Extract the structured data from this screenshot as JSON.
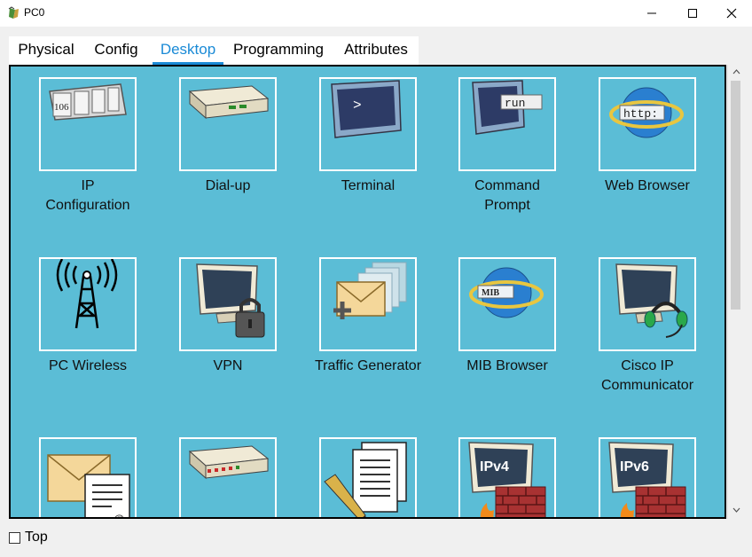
{
  "window": {
    "title": "PC0",
    "app_icon": "packet-tracer-pc-icon"
  },
  "tabs": [
    {
      "label": "Physical",
      "active": false
    },
    {
      "label": "Config",
      "active": false
    },
    {
      "label": "Desktop",
      "active": true
    },
    {
      "label": "Programming",
      "active": false
    },
    {
      "label": "Attributes",
      "active": false
    }
  ],
  "apps": [
    {
      "line1": "IP",
      "line2": "Configuration",
      "icon": "ip-configuration-icon",
      "icon_text": "106"
    },
    {
      "line1": "Dial-up",
      "line2": "",
      "icon": "dial-up-modem-icon"
    },
    {
      "line1": "Terminal",
      "line2": "",
      "icon": "terminal-icon",
      "icon_text": ">"
    },
    {
      "line1": "Command",
      "line2": "Prompt",
      "icon": "command-prompt-icon",
      "icon_text": "run"
    },
    {
      "line1": "Web Browser",
      "line2": "",
      "icon": "web-browser-icon",
      "icon_text": "http:"
    },
    {
      "line1": "PC Wireless",
      "line2": "",
      "icon": "wireless-antenna-icon"
    },
    {
      "line1": "VPN",
      "line2": "",
      "icon": "vpn-lock-icon"
    },
    {
      "line1": "Traffic Generator",
      "line2": "",
      "icon": "traffic-generator-icon"
    },
    {
      "line1": "MIB Browser",
      "line2": "",
      "icon": "mib-browser-icon",
      "icon_text": "MIB"
    },
    {
      "line1": "Cisco IP",
      "line2": "Communicator",
      "icon": "ip-communicator-headset-icon"
    },
    {
      "line1": "",
      "line2": "",
      "icon": "email-icon",
      "icon_text": "@"
    },
    {
      "line1": "",
      "line2": "",
      "icon": "pppoe-dialer-icon"
    },
    {
      "line1": "",
      "line2": "",
      "icon": "text-editor-icon"
    },
    {
      "line1": "",
      "line2": "",
      "icon": "ipv4-firewall-icon",
      "icon_text": "IPv4"
    },
    {
      "line1": "",
      "line2": "",
      "icon": "ipv6-firewall-icon",
      "icon_text": "IPv6"
    }
  ],
  "footer": {
    "top_label": "Top",
    "top_checked": false
  },
  "colors": {
    "panel": "#5bbdd6",
    "active_tab": "#1a8ad6"
  }
}
